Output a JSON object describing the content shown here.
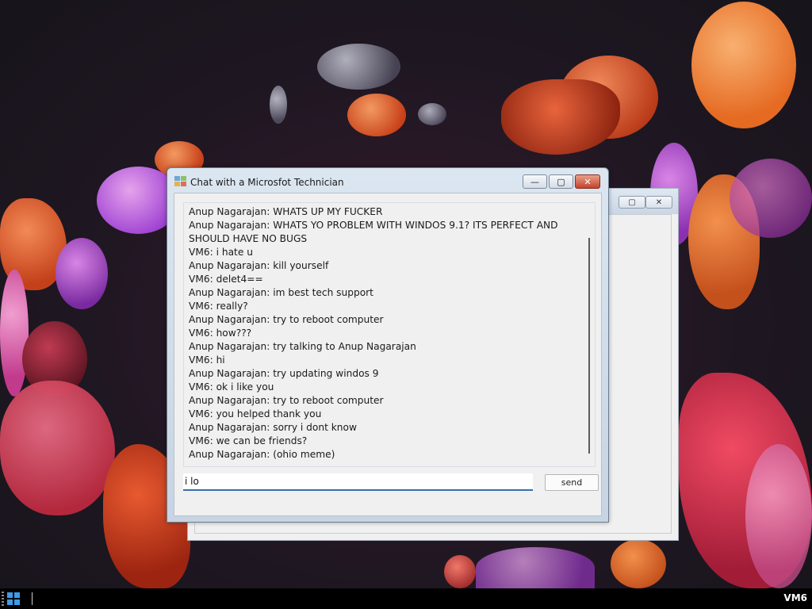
{
  "desktop": {
    "background_window": {
      "buttons": [
        "▭",
        "▢",
        "✕"
      ]
    }
  },
  "chat_window": {
    "title": "Chat with a Microsfot Technician",
    "controls": {
      "minimize": "—",
      "maximize": "▢",
      "close": "✕"
    },
    "messages": [
      "Anup Nagarajan: WHATS UP MY FUCKER",
      "Anup Nagarajan: WHATS YO PROBLEM WITH WINDOS 9.1? ITS PERFECT AND SHOULD HAVE NO BUGS",
      "VM6: i hate u",
      "Anup Nagarajan: kill yourself",
      "VM6: delet4==",
      "Anup Nagarajan: im best tech support",
      "VM6: really?",
      "Anup Nagarajan: try to reboot computer",
      "VM6: how???",
      "Anup Nagarajan: try talking to Anup Nagarajan",
      "VM6: hi",
      "Anup Nagarajan: try updating windos 9",
      "VM6: ok i like you",
      "Anup Nagarajan: try to reboot computer",
      "VM6: you helped thank you",
      "Anup Nagarajan: sorry i dont know",
      "VM6: we can be friends?",
      "Anup Nagarajan: (ohio meme)"
    ],
    "input_value": "i lo",
    "send_label": "send"
  },
  "taskbar": {
    "start_icon": "windows-logo",
    "tray_label": "VM6"
  },
  "colors": {
    "accent": "#3a6ea8",
    "windows_logo": "#3d9be9",
    "close_button": "#c4432a"
  }
}
